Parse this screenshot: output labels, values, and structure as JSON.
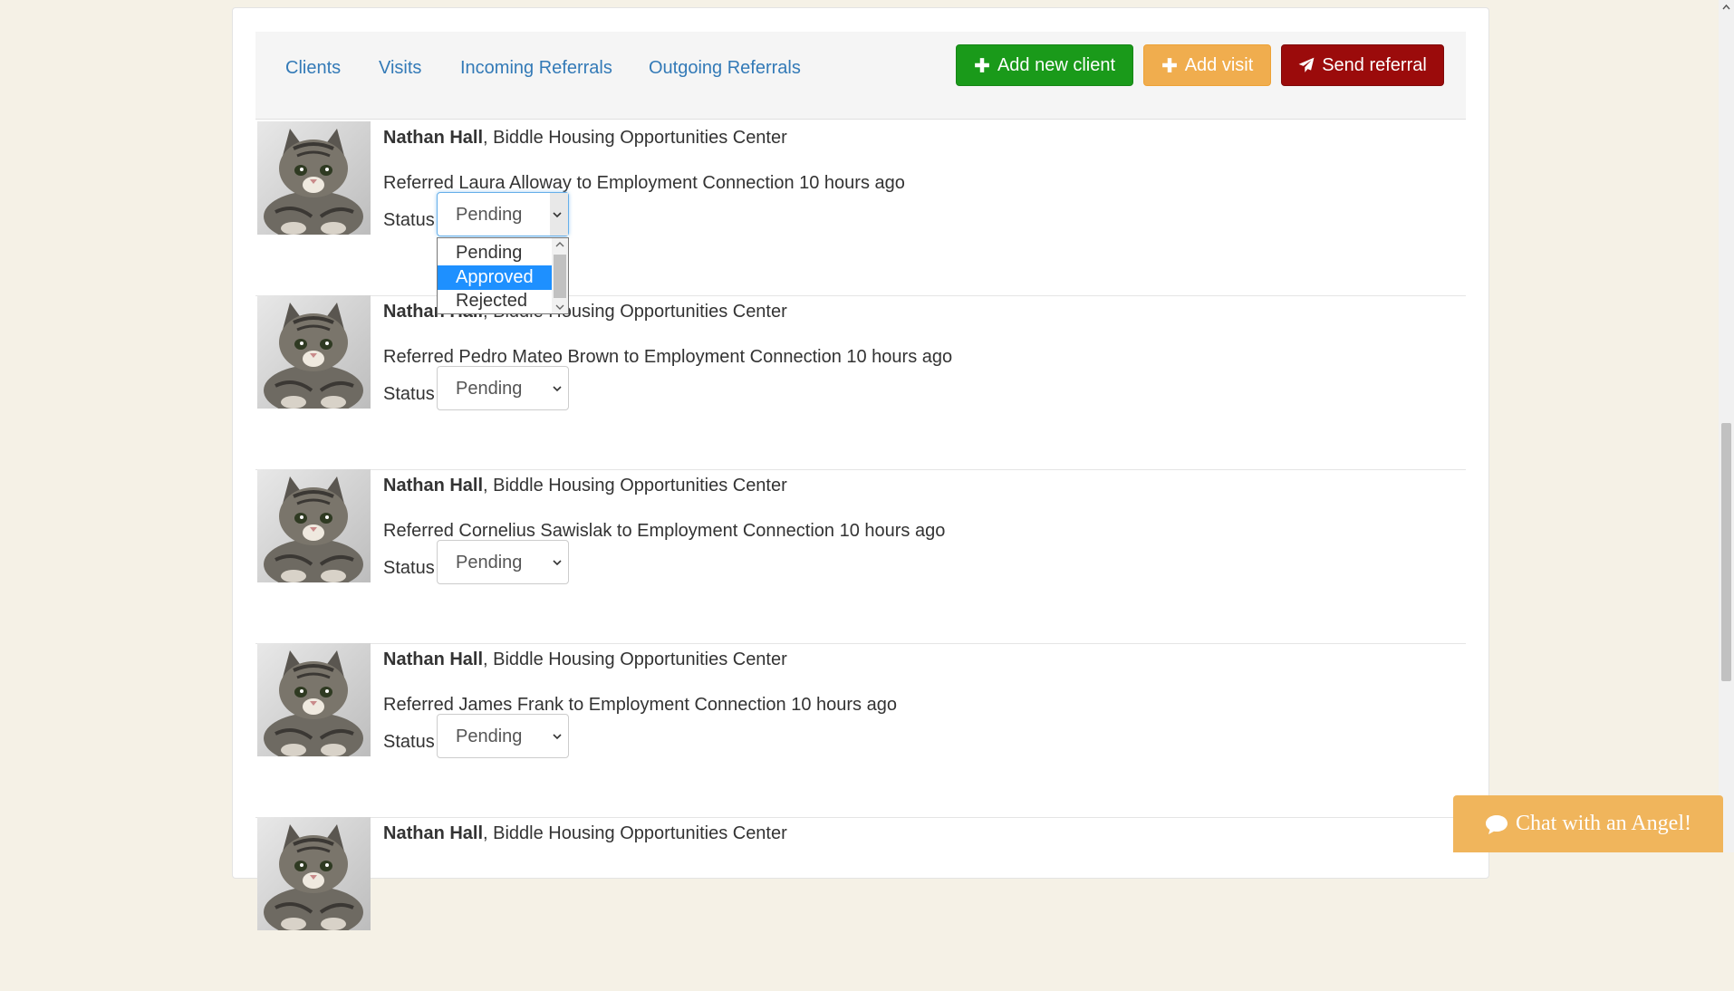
{
  "nav": {
    "links": [
      "Clients",
      "Visits",
      "Incoming Referrals",
      "Outgoing Referrals"
    ],
    "buttons": {
      "add_client": "Add new client",
      "add_visit": "Add visit",
      "send_referral": "Send referral"
    }
  },
  "referrals": [
    {
      "author": "Nathan Hall",
      "org": ", Biddle Housing Opportunities Center",
      "text": "Referred Laura Alloway to Employment Connection 10 hours ago",
      "status_label": "Status",
      "status": "Pending"
    },
    {
      "author": "Nathan Hall",
      "org": ", Biddle Housing Opportunities Center",
      "text": "Referred Pedro Mateo Brown to Employment Connection 10 hours ago",
      "status_label": "Status",
      "status": "Pending"
    },
    {
      "author": "Nathan Hall",
      "org": ", Biddle Housing Opportunities Center",
      "text": "Referred Cornelius Sawislak to Employment Connection 10 hours ago",
      "status_label": "Status",
      "status": "Pending"
    },
    {
      "author": "Nathan Hall",
      "org": ", Biddle Housing Opportunities Center",
      "text": "Referred James Frank to Employment Connection 10 hours ago",
      "status_label": "Status",
      "status": "Pending"
    },
    {
      "author": "Nathan Hall",
      "org": ", Biddle Housing Opportunities Center",
      "text": "",
      "status_label": "",
      "status": ""
    }
  ],
  "dropdown": {
    "options": [
      "Pending",
      "Approved",
      "Rejected"
    ],
    "highlighted": "Approved"
  },
  "chat": {
    "label": "Chat with an Angel!"
  },
  "colors": {
    "primary": "#337ab7",
    "green": "#1a9a1a",
    "orange": "#f0ad4e",
    "red": "#9b0b0b",
    "page_bg": "#f5f1e6"
  }
}
